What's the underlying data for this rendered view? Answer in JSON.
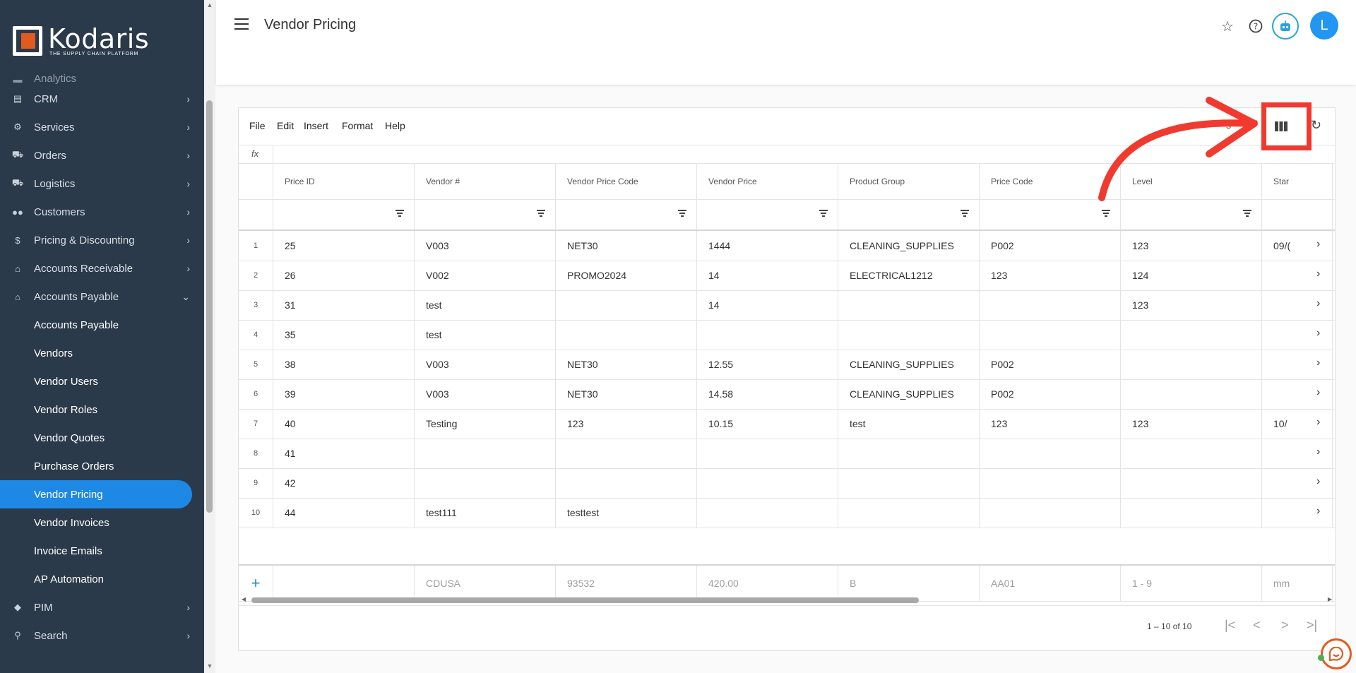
{
  "brand": {
    "name": "Kodaris",
    "tagline": "THE SUPPLY CHAIN PLATFORM"
  },
  "sidebar": {
    "partial_top": "Analytics",
    "items": [
      {
        "label": "CRM",
        "icon": "id-card-icon"
      },
      {
        "label": "Services",
        "icon": "cogs-icon"
      },
      {
        "label": "Orders",
        "icon": "truck-icon"
      },
      {
        "label": "Logistics",
        "icon": "shipping-icon"
      },
      {
        "label": "Customers",
        "icon": "users-icon"
      },
      {
        "label": "Pricing & Discounting",
        "icon": "dollar-icon"
      },
      {
        "label": "Accounts Receivable",
        "icon": "bank-icon"
      },
      {
        "label": "Accounts Payable",
        "icon": "bank-icon",
        "expanded": true
      }
    ],
    "sub_items": [
      "Accounts Payable",
      "Vendors",
      "Vendor Users",
      "Vendor Roles",
      "Vendor Quotes",
      "Purchase Orders",
      "Vendor Pricing",
      "Vendor Invoices",
      "Invoice Emails",
      "AP Automation"
    ],
    "active_sub": "Vendor Pricing",
    "bottom_items": [
      {
        "label": "PIM",
        "icon": "tag-icon"
      },
      {
        "label": "Search",
        "icon": "search-icon"
      }
    ]
  },
  "header": {
    "title": "Vendor Pricing",
    "avatar_letter": "L"
  },
  "toolbar": {
    "menus": [
      "File",
      "Edit",
      "Insert",
      "Format",
      "Help"
    ],
    "views_label": "s",
    "fx": "fx"
  },
  "table": {
    "columns": [
      "Price ID",
      "Vendor #",
      "Vendor Price Code",
      "Vendor Price",
      "Product Group",
      "Price Code",
      "Level",
      "Star"
    ],
    "rows": [
      {
        "n": "1",
        "cells": [
          "25",
          "V003",
          "NET30",
          "1444",
          "CLEANING_SUPPLIES",
          "P002",
          "123",
          "09/("
        ]
      },
      {
        "n": "2",
        "cells": [
          "26",
          "V002",
          "PROMO2024",
          "14",
          "ELECTRICAL1212",
          "123",
          "124",
          ""
        ]
      },
      {
        "n": "3",
        "cells": [
          "31",
          "test",
          "",
          "14",
          "",
          "",
          "123",
          ""
        ]
      },
      {
        "n": "4",
        "cells": [
          "35",
          "test",
          "",
          "",
          "",
          "",
          "",
          ""
        ]
      },
      {
        "n": "5",
        "cells": [
          "38",
          "V003",
          "NET30",
          "12.55",
          "CLEANING_SUPPLIES",
          "P002",
          "",
          ""
        ]
      },
      {
        "n": "6",
        "cells": [
          "39",
          "V003",
          "NET30",
          "14.58",
          "CLEANING_SUPPLIES",
          "P002",
          "",
          ""
        ]
      },
      {
        "n": "7",
        "cells": [
          "40",
          "Testing",
          "123",
          "10.15",
          "test",
          "123",
          "123",
          "10/"
        ]
      },
      {
        "n": "8",
        "cells": [
          "41",
          "",
          "",
          "",
          "",
          "",
          "",
          ""
        ]
      },
      {
        "n": "9",
        "cells": [
          "42",
          "",
          "",
          "",
          "",
          "",
          "",
          ""
        ]
      },
      {
        "n": "10",
        "cells": [
          "44",
          "test111",
          "testtest",
          "",
          "",
          "",
          "",
          ""
        ]
      }
    ],
    "new_row_placeholders": [
      "",
      "CDUSA",
      "93532",
      "420.00",
      "B",
      "AA01",
      "1 - 9",
      "mm"
    ],
    "paging": "1 – 10 of 10"
  }
}
